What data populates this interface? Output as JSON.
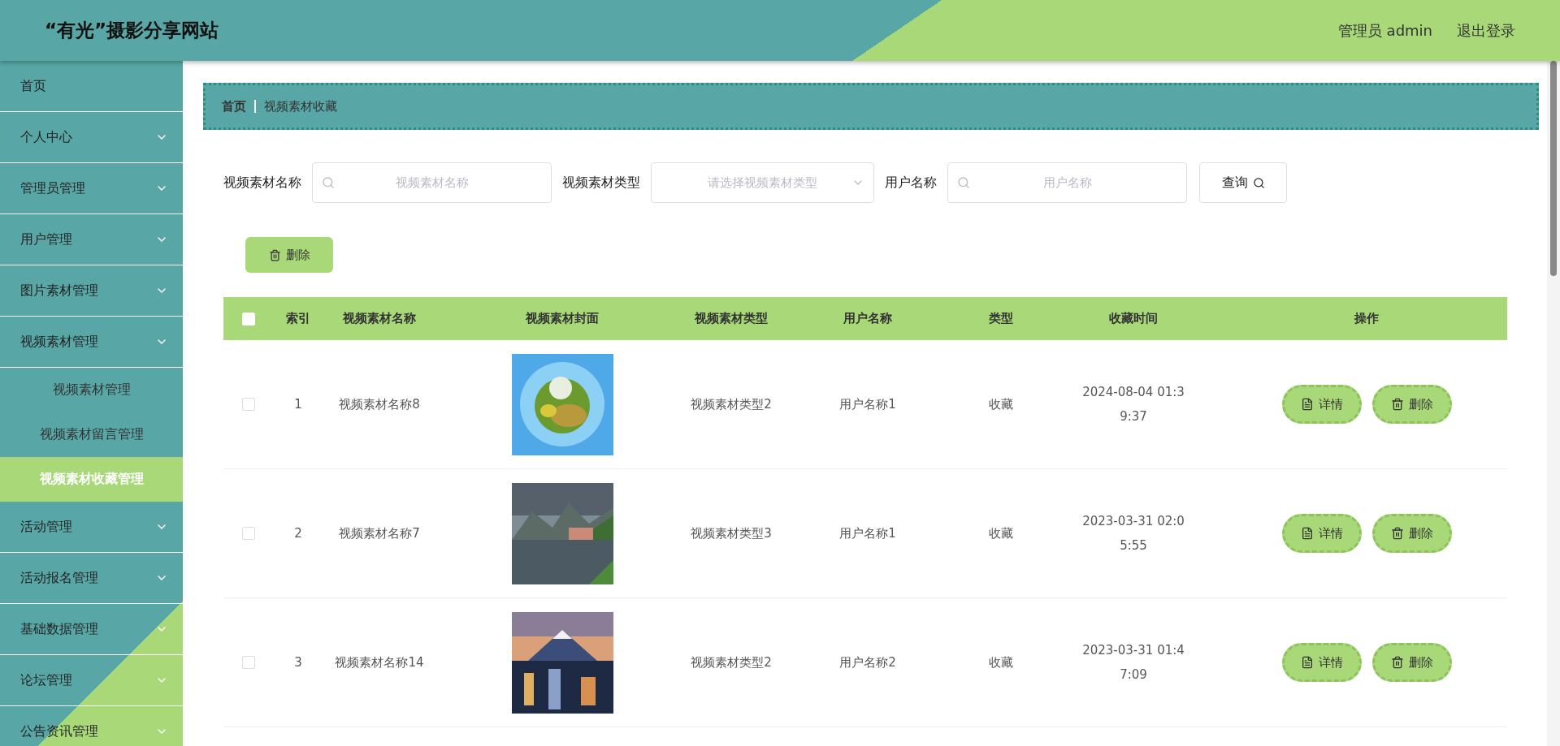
{
  "header": {
    "title": "“有光”摄影分享网站",
    "user": "管理员 admin",
    "logout": "退出登录"
  },
  "sidebar": {
    "items": [
      {
        "label": "首页",
        "kind": "link",
        "selected": false
      },
      {
        "label": "个人中心",
        "kind": "group"
      },
      {
        "label": "管理员管理",
        "kind": "group"
      },
      {
        "label": "用户管理",
        "kind": "group"
      },
      {
        "label": "图片素材管理",
        "kind": "group"
      },
      {
        "label": "视频素材管理",
        "kind": "group",
        "children": [
          {
            "label": "视频素材管理",
            "selected": false
          },
          {
            "label": "视频素材留言管理",
            "selected": false
          },
          {
            "label": "视频素材收藏管理",
            "selected": true
          }
        ]
      },
      {
        "label": "活动管理",
        "kind": "group"
      },
      {
        "label": "活动报名管理",
        "kind": "group"
      },
      {
        "label": "基础数据管理",
        "kind": "group"
      },
      {
        "label": "论坛管理",
        "kind": "group"
      },
      {
        "label": "公告资讯管理",
        "kind": "group"
      }
    ]
  },
  "breadcrumb": [
    "首页",
    "视频素材收藏"
  ],
  "filters": [
    {
      "kind": "search",
      "label": "视频素材名称",
      "placeholder": "视频素材名称"
    },
    {
      "kind": "select",
      "label": "视频素材类型",
      "placeholder": "请选择视频素材类型"
    },
    {
      "kind": "search",
      "label": "用户名称",
      "placeholder": "用户名称"
    }
  ],
  "query_button": "查询",
  "delete_button": "删除",
  "table": {
    "select_all_checked": false,
    "columns": [
      "索引",
      "视频素材名称",
      "视频素材封面",
      "视频素材类型",
      "用户名称",
      "类型",
      "收藏时间",
      "操作"
    ],
    "rows": [
      {
        "checked": false,
        "index": "1",
        "name": "视频素材名称8",
        "cover": {
          "kind": "picture"
        },
        "type": "视频素材类型2",
        "user": "用户名称1",
        "kind": "收藏",
        "time": "2024-08-04 01:39:37",
        "actions": [
          "详情",
          "删除"
        ]
      },
      {
        "checked": false,
        "index": "2",
        "name": "视频素材名称7",
        "cover": {
          "kind": "picture"
        },
        "type": "视频素材类型3",
        "user": "用户名称1",
        "kind": "收藏",
        "time": "2023-03-31 02:05:55",
        "actions": [
          "详情",
          "删除"
        ]
      },
      {
        "checked": false,
        "index": "3",
        "name": "视频素材名称14",
        "cover": {
          "kind": "picture"
        },
        "type": "视频素材类型2",
        "user": "用户名称2",
        "kind": "收藏",
        "time": "2023-03-31 01:47:09",
        "actions": [
          "详情",
          "删除"
        ]
      }
    ]
  }
}
